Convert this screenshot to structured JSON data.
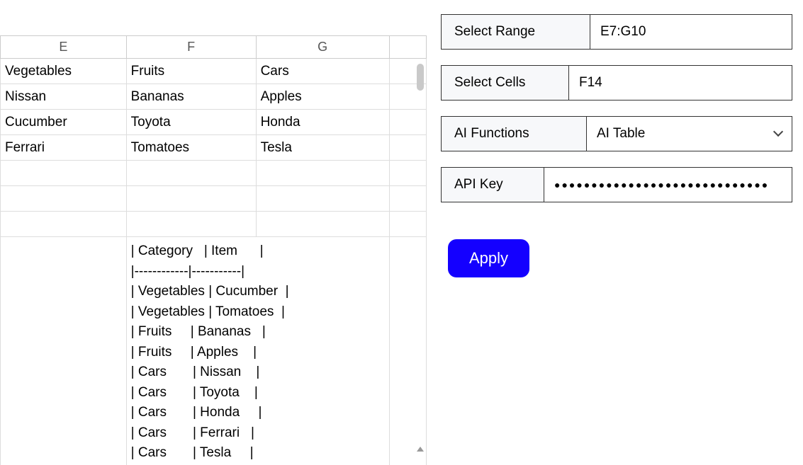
{
  "spreadsheet": {
    "columns": [
      "E",
      "F",
      "G",
      ""
    ],
    "rows": [
      {
        "E": "Vegetables",
        "F": "Fruits",
        "G": "Cars"
      },
      {
        "E": "Nissan",
        "F": "Bananas",
        "G": "Apples"
      },
      {
        "E": "Cucumber",
        "F": "Toyota",
        "G": "Honda"
      },
      {
        "E": "Ferrari",
        "F": "Tomatoes",
        "G": "Tesla"
      },
      {
        "E": "",
        "F": "",
        "G": ""
      },
      {
        "E": "",
        "F": "",
        "G": ""
      },
      {
        "E": "",
        "F": "",
        "G": ""
      }
    ],
    "result_cell": "| Category   | Item      |\n|------------|-----------|\n| Vegetables | Cucumber  |\n| Vegetables | Tomatoes  |\n| Fruits     | Bananas   |\n| Fruits     | Apples    |\n| Cars       | Nissan    |\n| Cars       | Toyota    |\n| Cars       | Honda     |\n| Cars       | Ferrari   |\n| Cars       | Tesla     |"
  },
  "sidebar": {
    "range": {
      "label": "Select Range",
      "value": "E7:G10"
    },
    "cells": {
      "label": "Select Cells",
      "value": "F14"
    },
    "functions": {
      "label": "AI Functions",
      "value": "AI Table"
    },
    "apikey": {
      "label": "API Key",
      "value": "●●●●●●●●●●●●●●●●●●●●●●●●●●●●●"
    },
    "apply_label": "Apply"
  }
}
